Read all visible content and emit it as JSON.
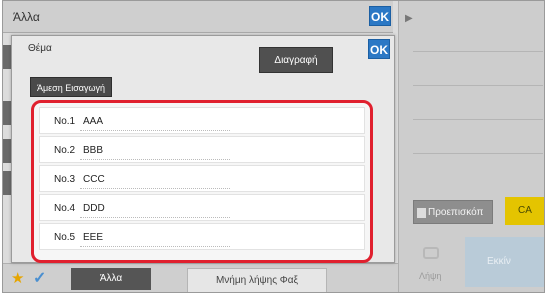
{
  "title_bar": {
    "title": "Άλλα",
    "ok_label": "OK"
  },
  "right_panel": {
    "preview_label": "Προεπισκόπ",
    "ca_label": "CA",
    "receive_label": "Λήψη",
    "start_label": "Εκκίν"
  },
  "bottom_bar": {
    "other_label": "Άλλα",
    "memory_label": "Μνήμη λήψης Φαξ"
  },
  "dialog": {
    "title": "Θέμα",
    "ok_label": "OK",
    "delete_label": "Διαγραφή",
    "direct_entry_label": "Άμεση Εισαγωγή",
    "items": [
      {
        "no": "No.1",
        "name": "AAA"
      },
      {
        "no": "No.2",
        "name": "BBB"
      },
      {
        "no": "No.3",
        "name": "CCC"
      },
      {
        "no": "No.4",
        "name": "DDD"
      },
      {
        "no": "No.5",
        "name": "EEE"
      }
    ]
  },
  "colors": {
    "ok_blue": "#2b78c5",
    "highlight_red": "#e0202e",
    "ca_yellow": "#e4c400"
  }
}
